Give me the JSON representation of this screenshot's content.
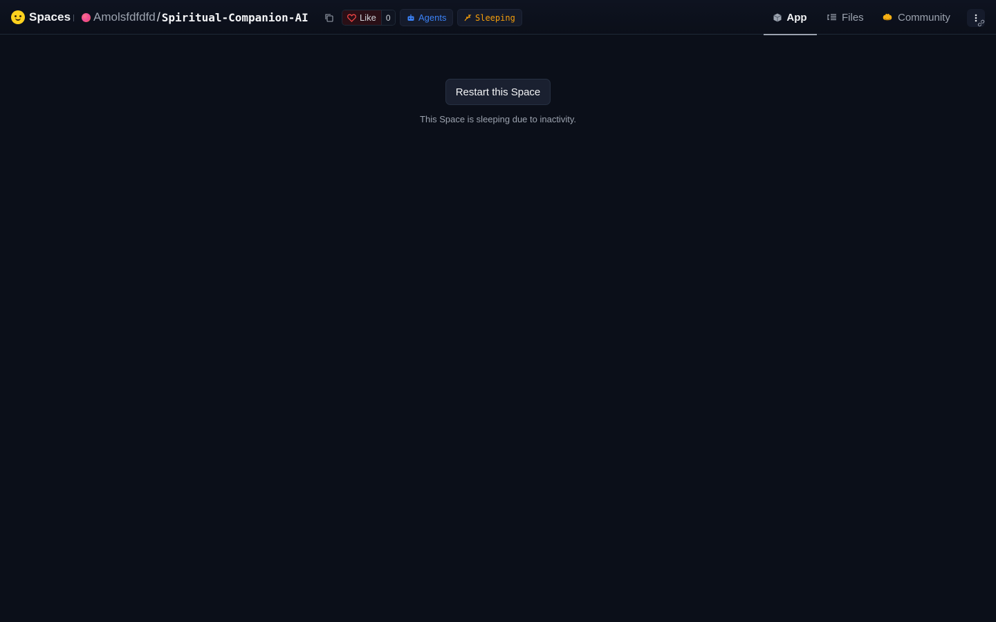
{
  "header": {
    "brand": "Spaces",
    "owner": "Amolsfdfdfd",
    "separator": "/",
    "repo_name": "Spiritual-Companion-AI",
    "like_label": "Like",
    "like_count": "0",
    "agents_label": "Agents",
    "status_label": "Sleeping"
  },
  "tabs": [
    {
      "label": "App",
      "icon": "cube-icon",
      "active": true
    },
    {
      "label": "Files",
      "icon": "files-icon",
      "active": false
    },
    {
      "label": "Community",
      "icon": "community-icon",
      "active": false
    }
  ],
  "main": {
    "restart_label": "Restart this Space",
    "message": "This Space is sleeping due to inactivity."
  },
  "colors": {
    "background": "#0b0f19",
    "agents_accent": "#3b82f6",
    "sleeping_accent": "#f59e0b",
    "like_heart": "#ef4444"
  }
}
